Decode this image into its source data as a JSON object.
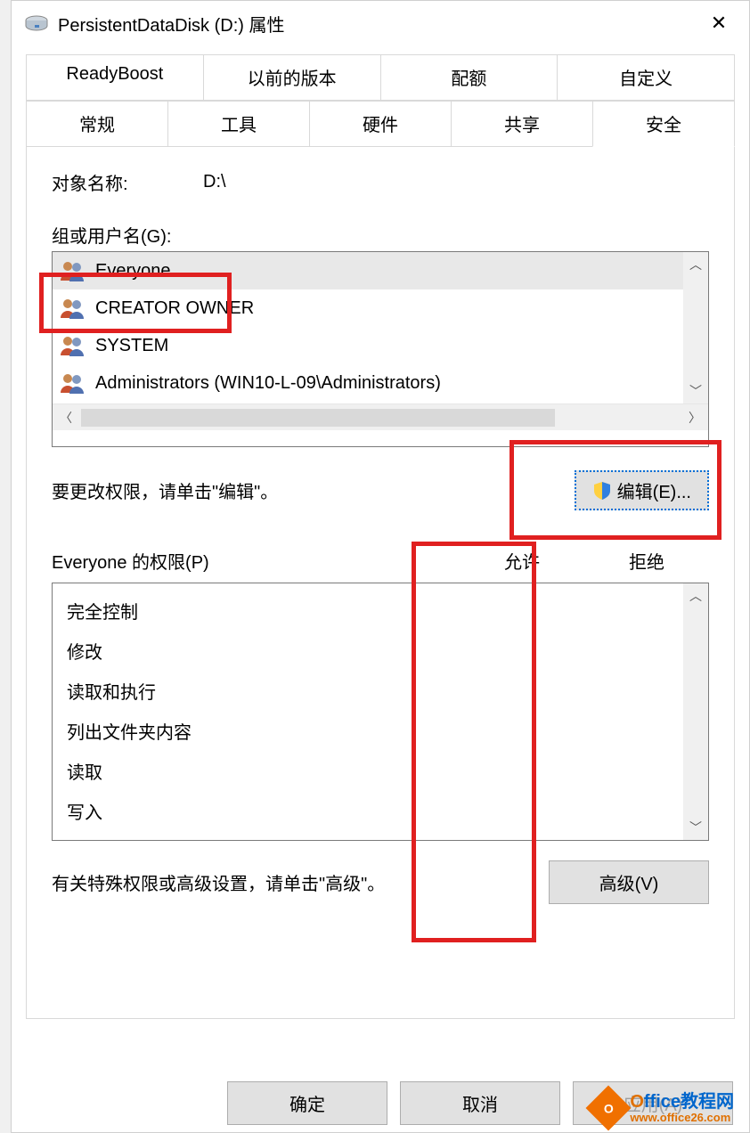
{
  "titlebar": {
    "title": "PersistentDataDisk (D:) 属性",
    "close": "✕"
  },
  "tabs": {
    "row1": [
      "ReadyBoost",
      "以前的版本",
      "配额",
      "自定义"
    ],
    "row2": [
      "常规",
      "工具",
      "硬件",
      "共享",
      "安全"
    ],
    "active": "安全"
  },
  "object": {
    "label": "对象名称:",
    "value": "D:\\"
  },
  "groups": {
    "label": "组或用户名(G):",
    "items": [
      "Everyone",
      "CREATOR OWNER",
      "SYSTEM",
      "Administrators (WIN10-L-09\\Administrators)"
    ],
    "selectedIndex": 0
  },
  "editRow": {
    "hint": "要更改权限，请单击\"编辑\"。",
    "button": "编辑(E)..."
  },
  "permHeader": {
    "label": "Everyone 的权限(P)",
    "allow": "允许",
    "deny": "拒绝"
  },
  "perms": [
    "完全控制",
    "修改",
    "读取和执行",
    "列出文件夹内容",
    "读取",
    "写入"
  ],
  "advRow": {
    "hint": "有关特殊权限或高级设置，请单击\"高级\"。",
    "button": "高级(V)"
  },
  "footer": {
    "ok": "确定",
    "cancel": "取消",
    "apply": "应用(A)"
  },
  "watermark": {
    "line1": "Office教程网",
    "line2": "www.office26.com"
  }
}
